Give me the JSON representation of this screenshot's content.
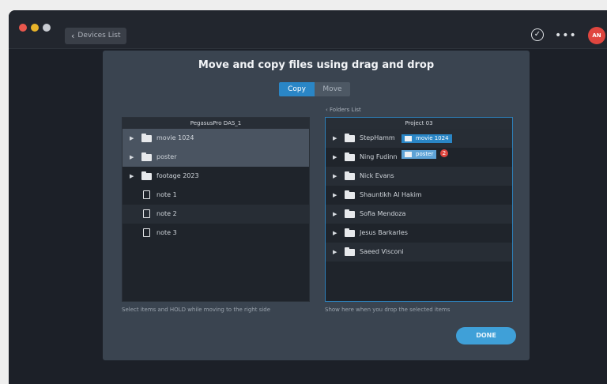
{
  "window": {
    "back_label": "Devices List",
    "avatar_initials": "AN"
  },
  "dialog": {
    "title": "Move and copy files using drag and drop",
    "mode_copy": "Copy",
    "mode_move": "Move",
    "active_mode": "Copy",
    "left_panel": {
      "title": "PegasusPro DAS_1",
      "items": [
        {
          "label": "movie 1024",
          "type": "folder",
          "state": "selected"
        },
        {
          "label": "poster",
          "type": "folder",
          "state": "selected"
        },
        {
          "label": "footage 2023",
          "type": "folder",
          "state": "normal"
        },
        {
          "label": "note 1",
          "type": "file",
          "state": "normal"
        },
        {
          "label": "note 2",
          "type": "file",
          "state": "alt"
        },
        {
          "label": "note 3",
          "type": "file",
          "state": "normal"
        }
      ],
      "hint": "Select items and HOLD while moving to the right side"
    },
    "right_panel": {
      "back_label": "Folders List",
      "title": "Project 03",
      "items": [
        {
          "label": "StepHamm",
          "type": "folder",
          "state": "alt"
        },
        {
          "label": "Ning Fudinn",
          "type": "folder",
          "state": "normal"
        },
        {
          "label": "Nick Evans",
          "type": "folder",
          "state": "alt"
        },
        {
          "label": "Shauntikh Al Hakim",
          "type": "folder",
          "state": "normal"
        },
        {
          "label": "Sofia Mendoza",
          "type": "folder",
          "state": "alt"
        },
        {
          "label": "Jesus Barkarles",
          "type": "folder",
          "state": "normal"
        },
        {
          "label": "Saeed Visconi",
          "type": "folder",
          "state": "alt"
        }
      ],
      "hint": "Show here when you drop the selected items"
    },
    "drag": {
      "items": [
        "movie 1024",
        "poster"
      ],
      "count": "2"
    },
    "done_label": "DONE"
  },
  "colors": {
    "accent": "#2a86c6",
    "done": "#3fa0d8",
    "badge": "#e0463f"
  }
}
